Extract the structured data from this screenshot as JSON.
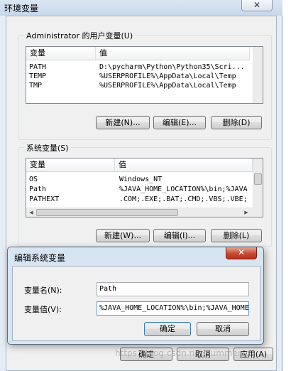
{
  "env_window": {
    "title": "环境变量",
    "close_glyph": "✕"
  },
  "user_vars": {
    "legend": "Administrator 的用户变量(U)",
    "columns": [
      "变量",
      "值"
    ],
    "rows": [
      {
        "name": "PATH",
        "value": "D:\\pycharm\\Python\\Python35\\Scri..."
      },
      {
        "name": "TEMP",
        "value": "%USERPROFILE%\\AppData\\Local\\Temp"
      },
      {
        "name": "TMP",
        "value": "%USERPROFILE%\\AppData\\Local\\Temp"
      }
    ],
    "buttons": {
      "new": "新建(N)...",
      "edit": "编辑(E)...",
      "delete": "删除(D)"
    }
  },
  "system_vars": {
    "legend": "系统变量(S)",
    "columns": [
      "变量",
      "值"
    ],
    "rows": [
      {
        "name": "OS",
        "value": "Windows_NT"
      },
      {
        "name": "Path",
        "value": "%JAVA_HOME_LOCATION%\\bin;%JAVA"
      },
      {
        "name": "PATHEXT",
        "value": ".COM;.EXE;.BAT;.CMD;.VBS;.VBE;"
      }
    ],
    "buttons": {
      "new": "新建(W)...",
      "edit": "编辑(I)...",
      "delete": "删除(L)"
    }
  },
  "env_footer": {
    "ok": "确定",
    "cancel": "取消",
    "apply": "应用(A)"
  },
  "edit_dialog": {
    "title": "编辑系统变量",
    "close_glyph": "✕",
    "name_label": "变量名(N):",
    "name_value": "Path",
    "value_label": "变量值(V):",
    "value_value": "%JAVA_HOME_LOCATION%\\bin;%JAVA_HOME%",
    "ok": "确定",
    "cancel": "取消"
  },
  "watermark": "https://blog.csdn.net/summer..."
}
